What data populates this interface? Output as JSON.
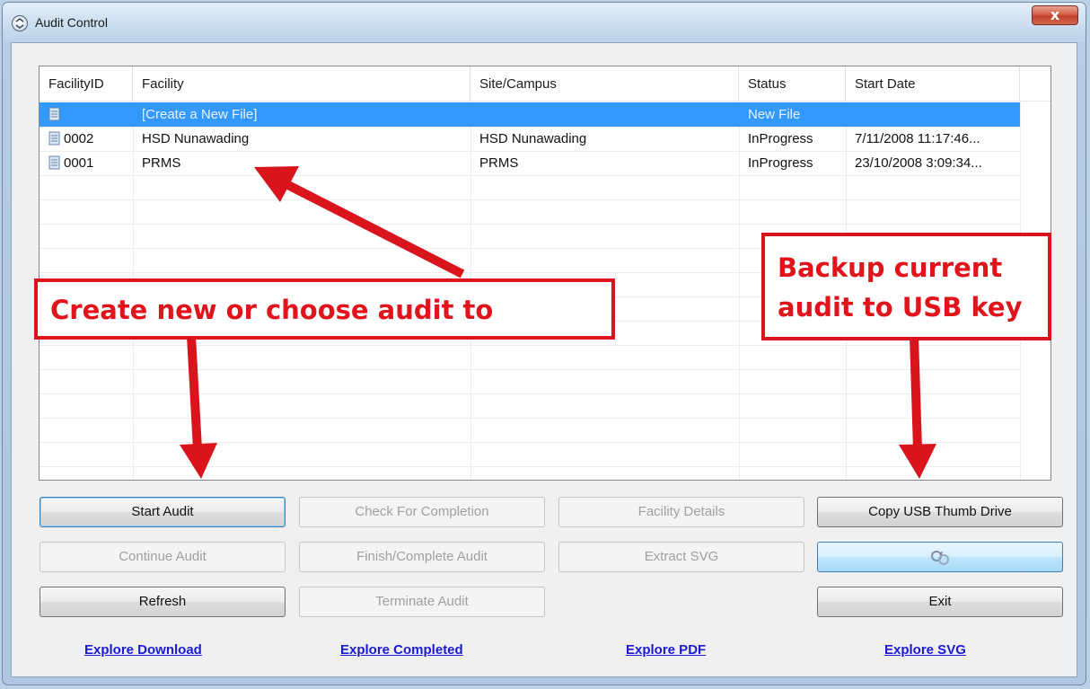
{
  "window": {
    "title": "Audit Control",
    "close_label": "x"
  },
  "listview": {
    "columns": [
      "FacilityID",
      "Facility",
      "Site/Campus",
      "Status",
      "Start Date"
    ],
    "rows": [
      {
        "id": "",
        "facility": "[Create a New File]",
        "site": "",
        "status": "New File",
        "start": "",
        "selected": true
      },
      {
        "id": "0002",
        "facility": "HSD Nunawading",
        "site": "HSD Nunawading",
        "status": "InProgress",
        "start": "7/11/2008 11:17:46...",
        "selected": false
      },
      {
        "id": "0001",
        "facility": "PRMS",
        "site": "PRMS",
        "status": "InProgress",
        "start": "23/10/2008 3:09:34...",
        "selected": false
      }
    ]
  },
  "buttons": {
    "start_audit": "Start Audit",
    "check_completion": "Check For Completion",
    "facility_details": "Facility Details",
    "copy_usb": "Copy USB Thumb Drive",
    "continue_audit": "Continue Audit",
    "finish_audit": "Finish/Complete Audit",
    "extract_svg": "Extract SVG",
    "sync_icon": "sync-icon",
    "refresh": "Refresh",
    "terminate_audit": "Terminate Audit",
    "exit": "Exit"
  },
  "links": {
    "explore_download": "Explore Download",
    "explore_completed": "Explore Completed",
    "explore_pdf": "Explore PDF",
    "explore_svg": "Explore SVG"
  },
  "annotations": {
    "left_callout": "Create new or choose audit to",
    "right_callout_line1": "Backup current",
    "right_callout_line2": "audit to USB key",
    "color": "#d9141c"
  }
}
